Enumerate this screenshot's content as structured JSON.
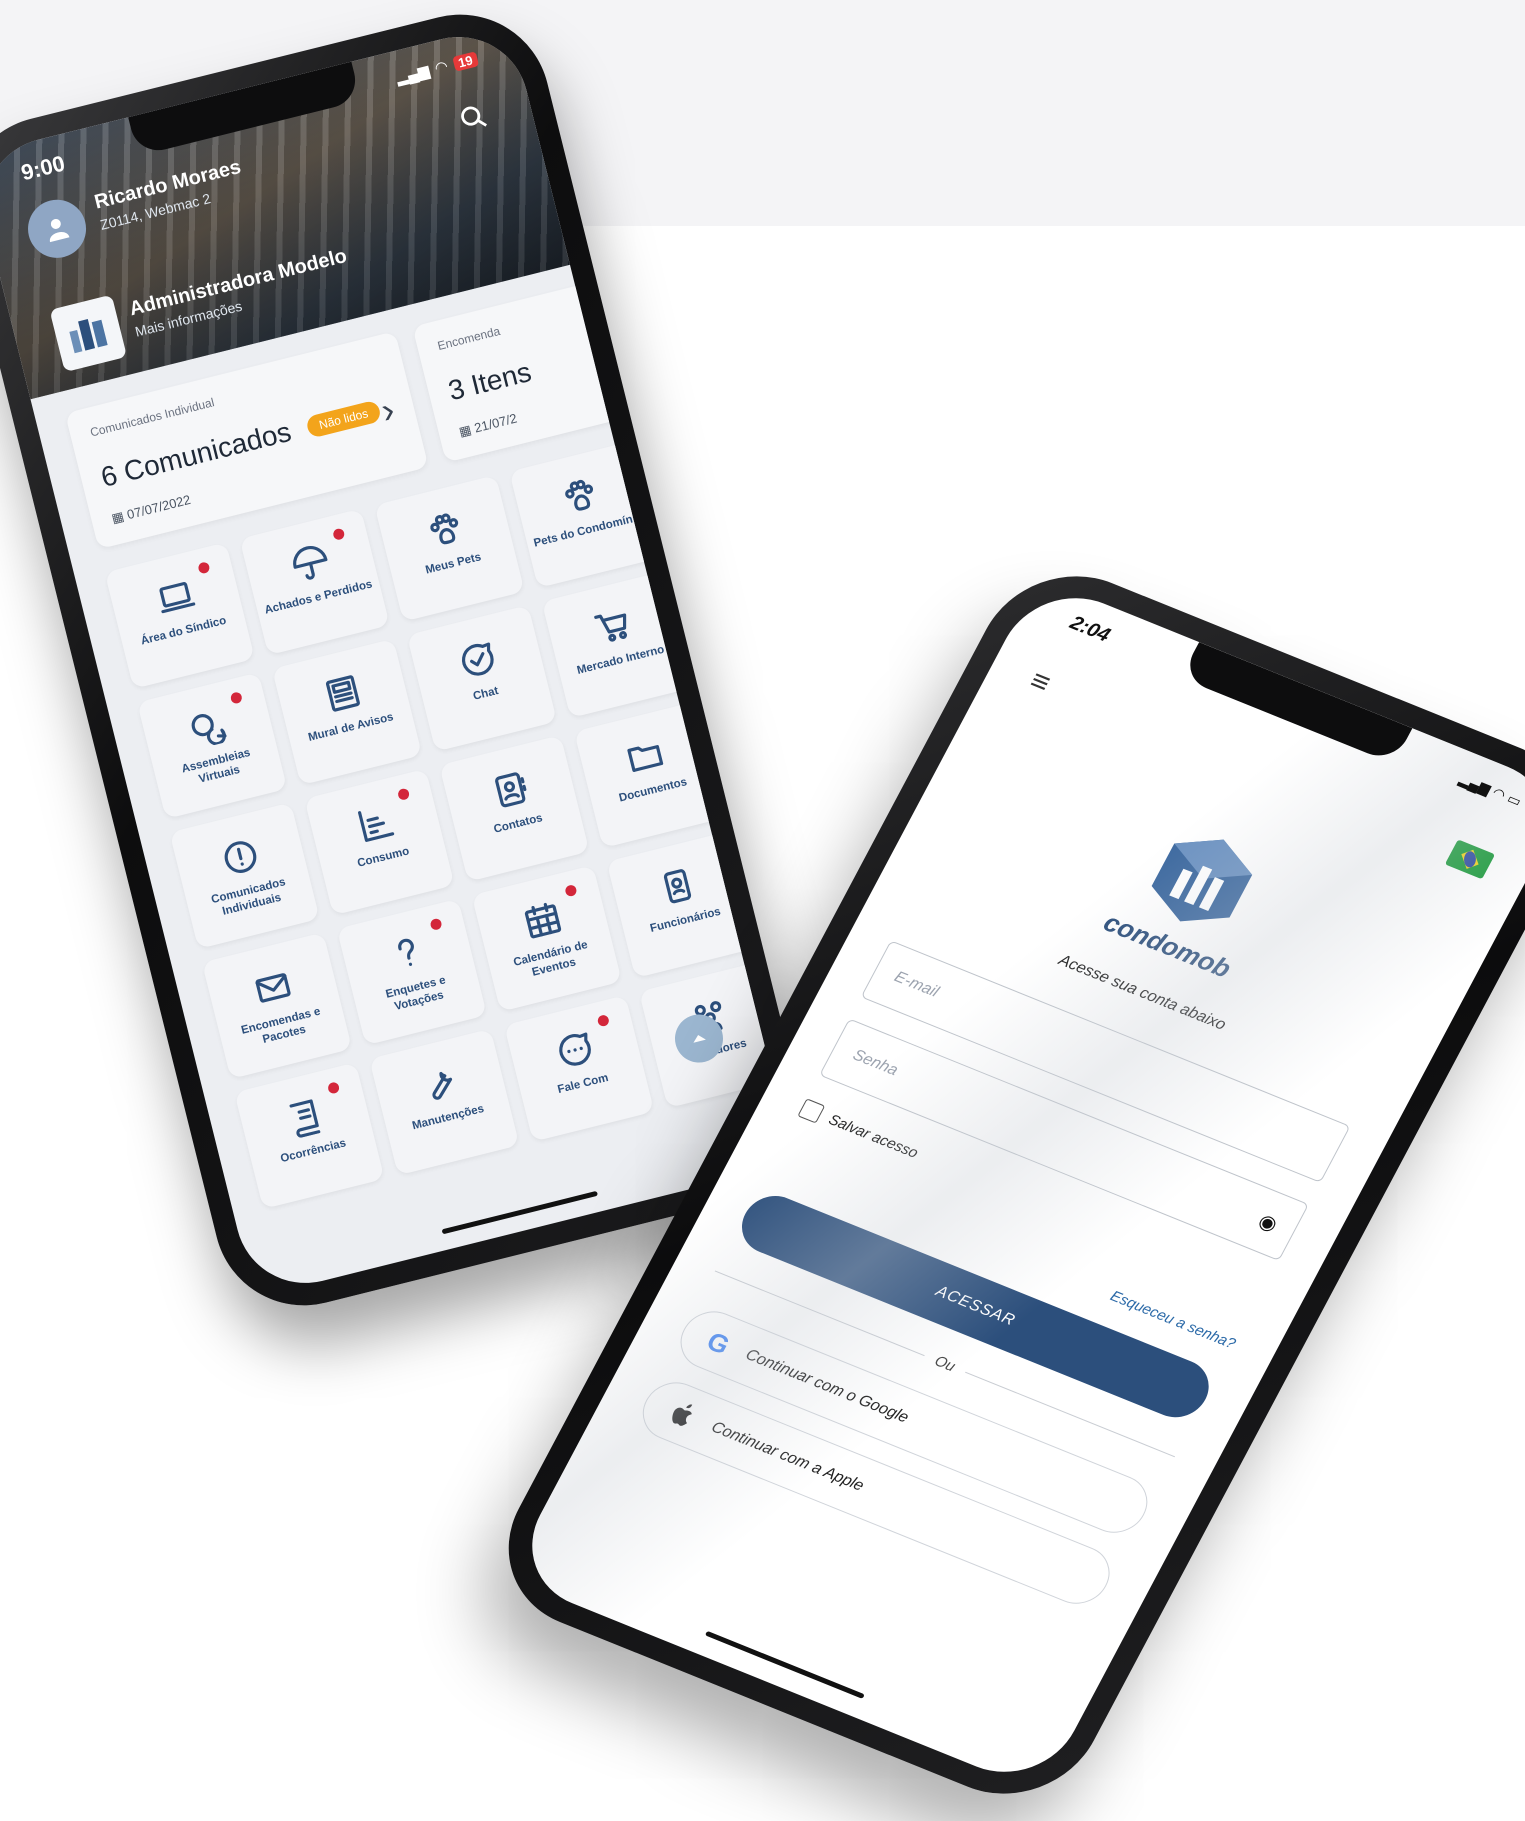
{
  "phone1": {
    "status": {
      "time": "9:00",
      "battery": "19"
    },
    "user": {
      "name": "Ricardo Moraes",
      "unit": "Z0114, Webmac 2"
    },
    "admin": {
      "name": "Administradora Modelo",
      "link": "Mais informações"
    },
    "cards": [
      {
        "label": "Comunicados Individual",
        "title": "6 Comunicados",
        "badge": "Não lidos",
        "date": "07/07/2022"
      },
      {
        "label": "Encomenda",
        "title": "3 Itens",
        "date": "21/07/2"
      }
    ],
    "tiles": [
      {
        "label": "Área do Síndico",
        "icon": "laptop-icon",
        "dot": true
      },
      {
        "label": "Achados e Perdidos",
        "icon": "umbrella-icon",
        "dot": true
      },
      {
        "label": "Meus Pets",
        "icon": "paw-icon",
        "dot": false
      },
      {
        "label": "Pets do Condomínio",
        "icon": "paw-icon",
        "dot": false
      },
      {
        "label": "Assembleias Virtuais",
        "icon": "chat-bubbles-icon",
        "dot": true
      },
      {
        "label": "Mural de Avisos",
        "icon": "newspaper-icon",
        "dot": false
      },
      {
        "label": "Chat",
        "icon": "chat-check-icon",
        "dot": false
      },
      {
        "label": "Mercado Interno",
        "icon": "cart-icon",
        "dot": false
      },
      {
        "label": "Comunicados Individuais",
        "icon": "alert-circle-icon",
        "dot": false
      },
      {
        "label": "Consumo",
        "icon": "chart-lines-icon",
        "dot": true
      },
      {
        "label": "Contatos",
        "icon": "contacts-icon",
        "dot": false
      },
      {
        "label": "Documentos",
        "icon": "folder-icon",
        "dot": false
      },
      {
        "label": "Encomendas e Pacotes",
        "icon": "envelope-icon",
        "dot": false
      },
      {
        "label": "Enquetes e Votações",
        "icon": "question-icon",
        "dot": true
      },
      {
        "label": "Calendário de Eventos",
        "icon": "calendar-icon",
        "dot": true
      },
      {
        "label": "Funcionários",
        "icon": "badge-icon",
        "dot": false
      },
      {
        "label": "Ocorrências",
        "icon": "book-icon",
        "dot": true
      },
      {
        "label": "Manutenções",
        "icon": "wrench-icon",
        "dot": false
      },
      {
        "label": "Fale Com",
        "icon": "speech-icon",
        "dot": true
      },
      {
        "label": "Moradores",
        "icon": "people-icon",
        "dot": false
      }
    ]
  },
  "phone2": {
    "status": {
      "time": "2:04"
    },
    "brand": "condomob",
    "tagline": "Acesse sua conta abaixo",
    "email_placeholder": "E-mail",
    "password_placeholder": "Senha",
    "save_access": "Salvar acesso",
    "forgot": "Esqueceu a senha?",
    "submit": "ACESSAR",
    "or": "Ou",
    "google": "Continuar com o Google",
    "apple": "Continuar com a Apple"
  },
  "colors": {
    "primary": "#2c4f7c",
    "badge": "#f3a41b",
    "dot": "#d3263a",
    "top_band": "#f4f4f6"
  }
}
